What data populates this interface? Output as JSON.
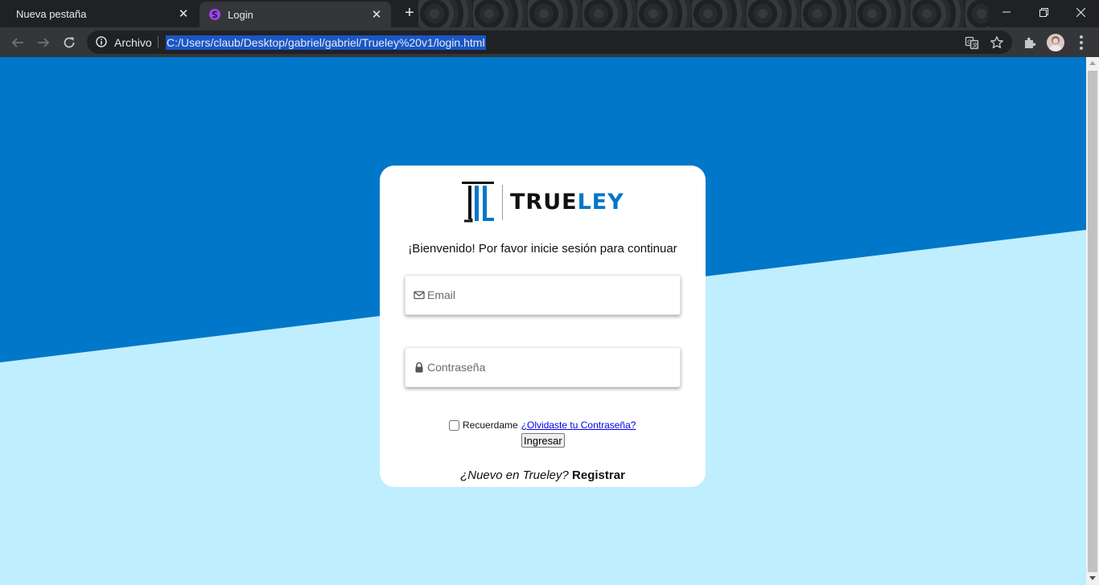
{
  "browser": {
    "tabs": [
      {
        "title": "Nueva pestaña",
        "active": false
      },
      {
        "title": "Login",
        "active": true
      }
    ],
    "address_label": "Archivo",
    "url": "C:/Users/claub/Desktop/gabriel/gabriel/Trueley%20v1/login.html"
  },
  "colors": {
    "background_top": "#0077c8",
    "background_bottom": "#bfeefe",
    "brand_accent": "#0077c8"
  },
  "login": {
    "brand_prefix": "TRUE",
    "brand_suffix": "LEY",
    "welcome": "¡Bienvenido! Por favor inicie sesión para continuar",
    "email_placeholder": "Email",
    "password_placeholder": "Contraseña",
    "remember_label": "Recuerdame",
    "forgot_link": "¿Olvidaste tu Contraseña?",
    "submit_label": "Ingresar",
    "signup_prompt": "¿Nuevo en Trueley?",
    "signup_link": "Registrar"
  }
}
